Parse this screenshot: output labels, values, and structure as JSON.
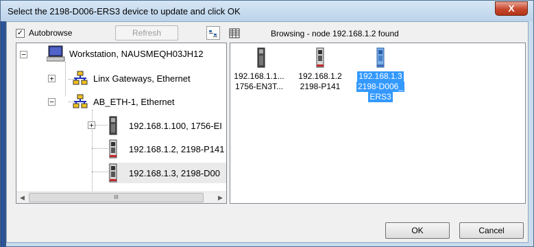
{
  "window": {
    "title": "Select the 2198-D006-ERS3 device to update and click OK",
    "close_glyph": "X"
  },
  "toolbar": {
    "autobrowse_label": "Autobrowse",
    "autobrowse_checked": true,
    "check_glyph": "✓",
    "refresh_label": "Refresh",
    "status": "Browsing - node 192.168.1.2 found"
  },
  "tree": {
    "items": [
      {
        "label": "Workstation, NAUSMEQH03JH12",
        "expander": "−",
        "icon": "workstation-icon"
      },
      {
        "label": "Linx Gateways, Ethernet",
        "expander": "+",
        "icon": "network-icon"
      },
      {
        "label": "AB_ETH-1, Ethernet",
        "expander": "−",
        "icon": "network-icon"
      },
      {
        "label": "192.168.1.100, 1756-EI",
        "expander": "+",
        "icon": "module-icon"
      },
      {
        "label": "192.168.1.2, 2198-P141",
        "icon": "drive-icon"
      },
      {
        "label": "192.168.1.3, 2198-D00",
        "icon": "drive-icon"
      }
    ],
    "scroll_left_glyph": "◀",
    "scroll_right_glyph": "▶",
    "scroll_thumb_grip": "III"
  },
  "devices": [
    {
      "line1": "192.168.1.1...",
      "line2": "1756-EN3T...",
      "icon": "module-icon",
      "selected": false
    },
    {
      "line1": "192.168.1.2",
      "line2": "2198-P141",
      "icon": "drive-icon",
      "selected": false
    },
    {
      "line1": "192.168.1.3",
      "line2": "2198-D006_",
      "line3": "ERS3",
      "icon": "drive-blue-icon",
      "selected": true
    }
  ],
  "buttons": {
    "ok": "OK",
    "cancel": "Cancel"
  },
  "colors": {
    "selection": "#3399ff",
    "close_button": "#c7472c"
  }
}
